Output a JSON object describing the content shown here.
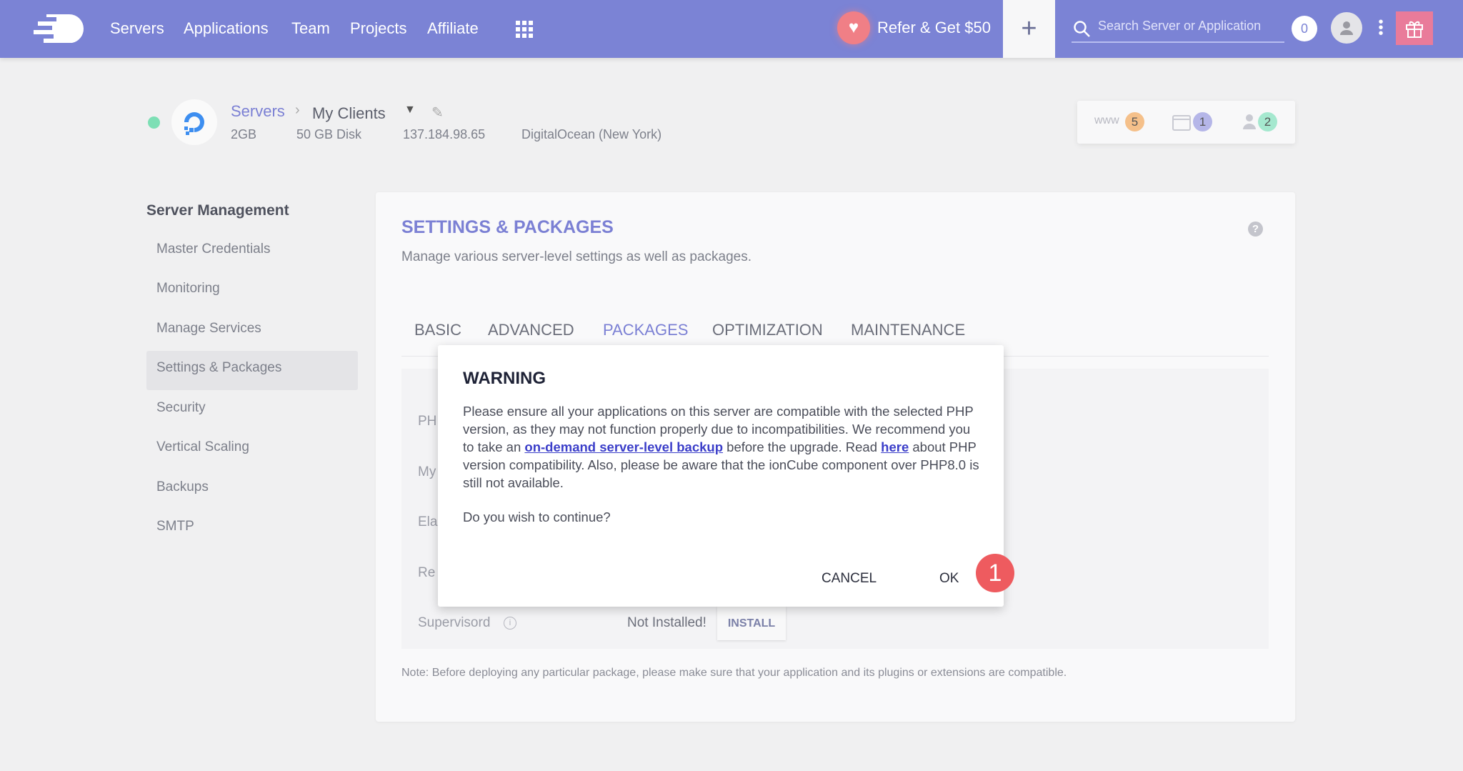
{
  "nav": {
    "items": [
      "Servers",
      "Applications",
      "Team",
      "Projects",
      "Affiliate"
    ],
    "refer": "Refer & Get $50",
    "search_placeholder": "Search Server or Application",
    "notifications": "0"
  },
  "header": {
    "breadcrumb_root": "Servers",
    "server_name": "My Clients",
    "ram": "2GB",
    "disk": "50 GB Disk",
    "ip": "137.184.98.65",
    "provider": "DigitalOcean (New York)",
    "status_color": "#7ddfb5",
    "stats": {
      "www_label": "www",
      "apps": "5",
      "folders": "1",
      "members": "2"
    }
  },
  "sidebar": {
    "title": "Server Management",
    "items": [
      "Master Credentials",
      "Monitoring",
      "Manage Services",
      "Settings & Packages",
      "Security",
      "Vertical Scaling",
      "Backups",
      "SMTP"
    ],
    "active": "Settings & Packages"
  },
  "main": {
    "title": "SETTINGS & PACKAGES",
    "subtitle": "Manage various server-level settings as well as packages.",
    "tabs": [
      "BASIC",
      "ADVANCED",
      "PACKAGES",
      "OPTIMIZATION",
      "MAINTENANCE"
    ],
    "active_tab": "PACKAGES",
    "rows": [
      "PH",
      "My",
      "Ela",
      "Re"
    ],
    "supervisord": {
      "label": "Supervisord",
      "status": "Not Installed!",
      "button": "INSTALL"
    },
    "note": "Note: Before deploying any particular package, please make sure that your application and its plugins or extensions are compatible."
  },
  "modal": {
    "title": "WARNING",
    "text1": "Please ensure all your applications on this server are compatible with the selected PHP version, as they may not function properly due to incompatibilities. We recommend you to take an ",
    "link1": "on-demand server-level backup",
    "text2": " before the upgrade. Read ",
    "link2": "here",
    "text3": " about PHP version compatibility. Also, please be aware that the ionCube component over PHP8.0 is still not available.",
    "question": "Do you wish to continue?",
    "cancel": "CANCEL",
    "ok": "OK",
    "step_badge": "1"
  },
  "colors": {
    "nav": "#7b83d5",
    "accent": "#7b80d4",
    "badge": "#ee5b5f"
  }
}
